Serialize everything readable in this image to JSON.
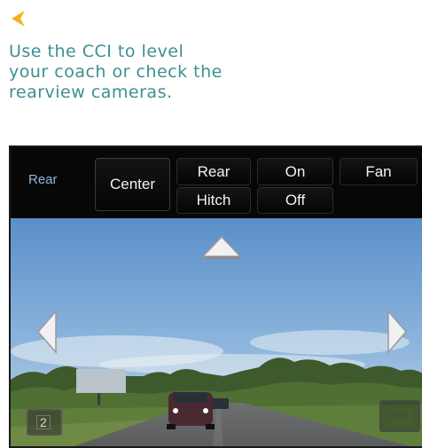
{
  "intro": {
    "back_icon": "chevron-left-icon",
    "line1": "Use the CCI to level",
    "line2": "your coach or check the",
    "line3": "rearview cameras."
  },
  "colors": {
    "accent": "#f6b21a",
    "intro_text": "#3d8f92",
    "camera_label": "#8fb6d8"
  },
  "camera_ui": {
    "view_label": "Rear",
    "buttons": {
      "center": "Center",
      "rear": "Rear",
      "hitch": "Hitch",
      "on": "On",
      "off": "Off",
      "fan": "Fan"
    },
    "camera_number": "2",
    "icons": {
      "up": "up-arrow-icon",
      "left": "left-arrow-icon",
      "right": "right-arrow-icon",
      "fullscreen": "fullscreen-icon"
    }
  }
}
